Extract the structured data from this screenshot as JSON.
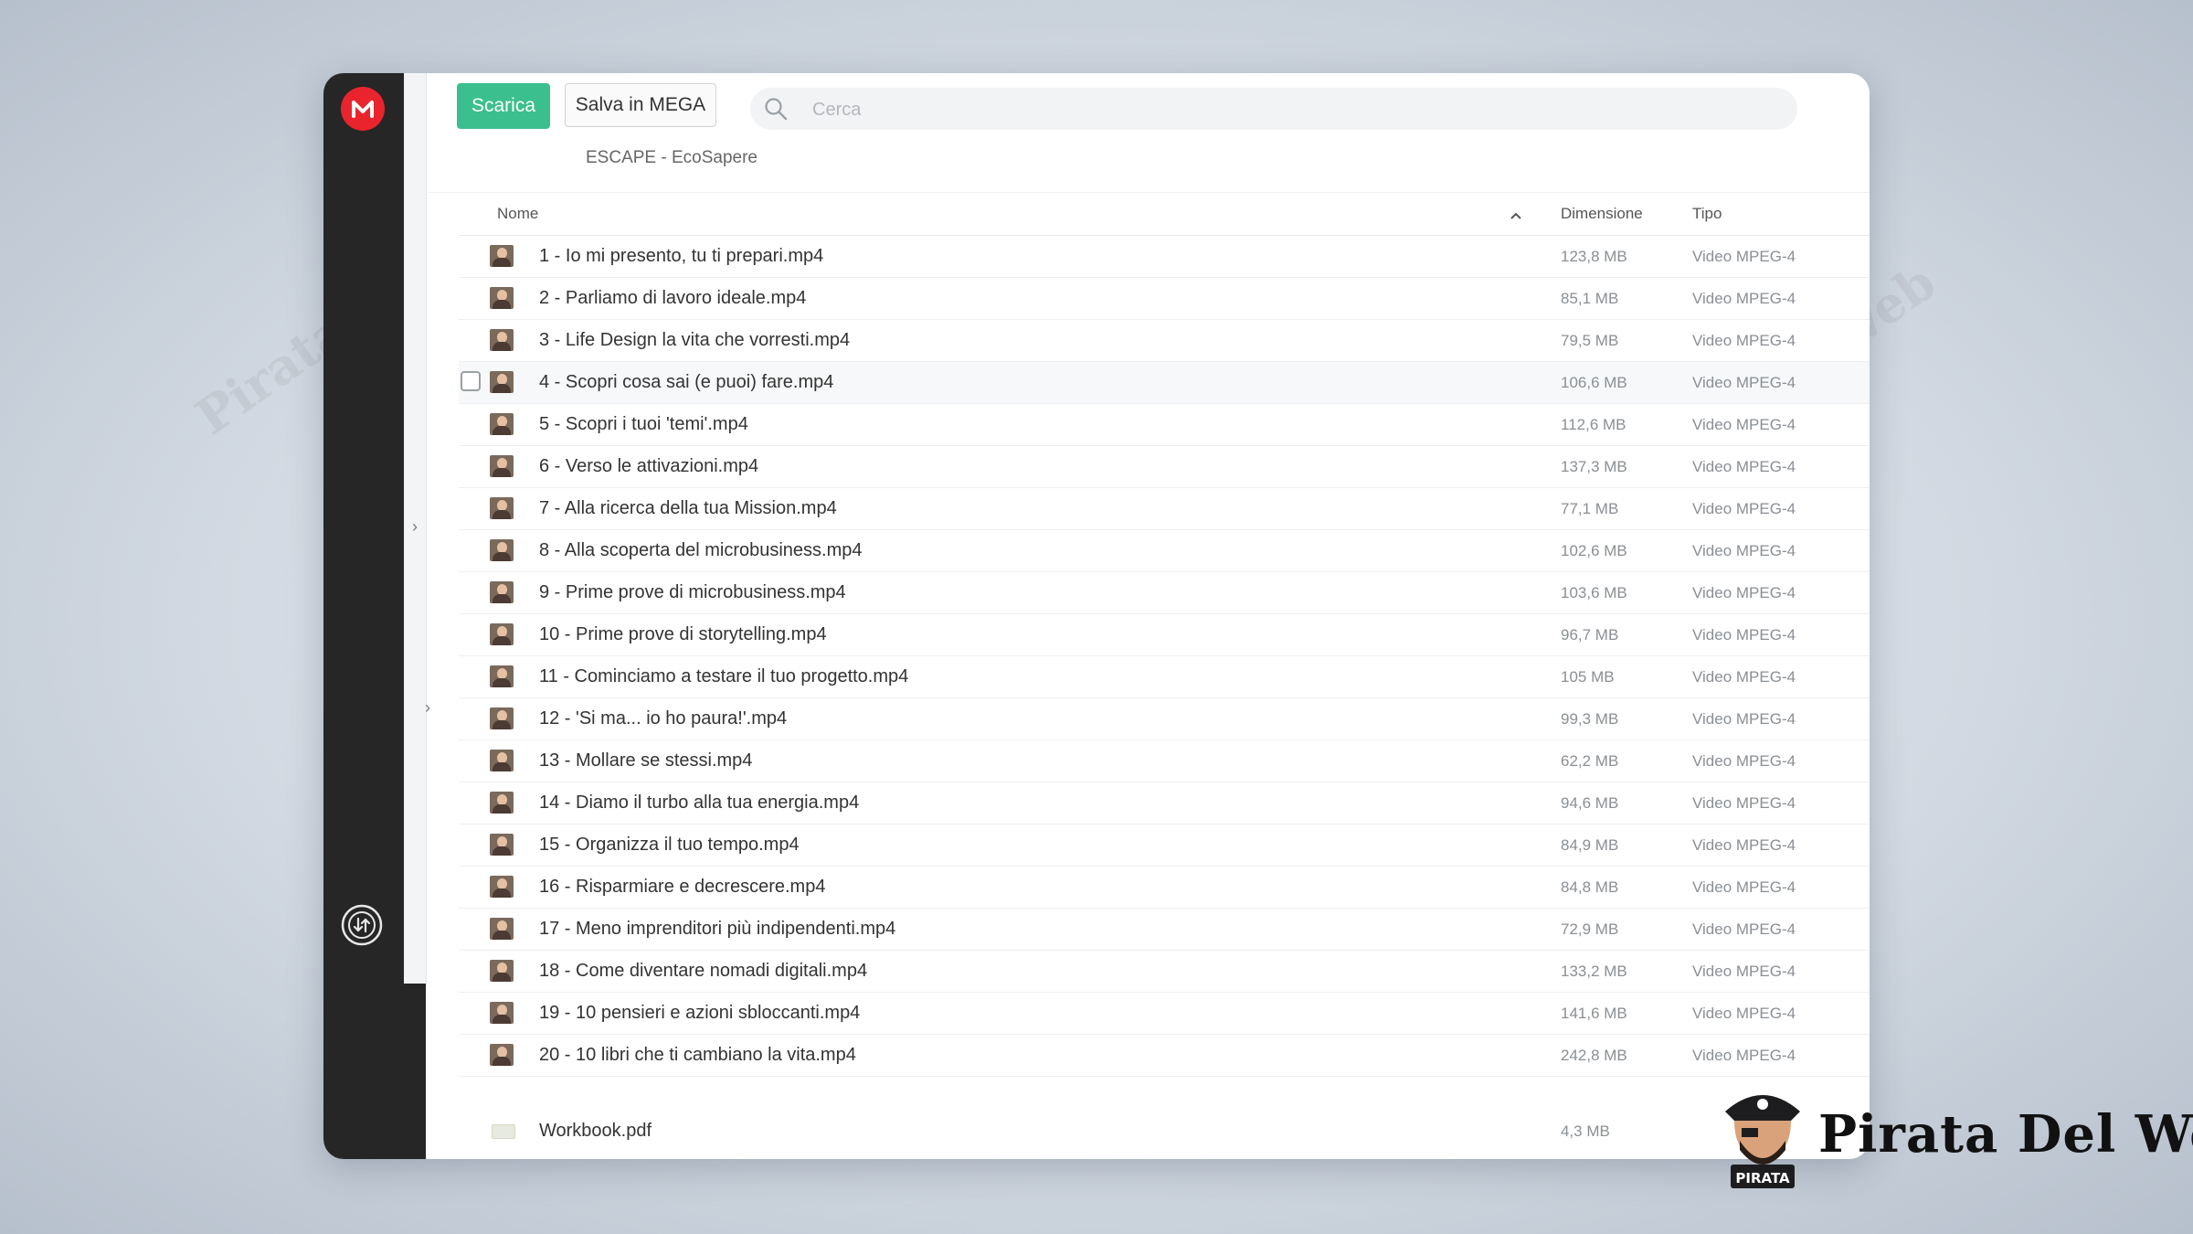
{
  "toolbar": {
    "download_label": "Scarica",
    "save_label": "Salva in MEGA"
  },
  "search": {
    "placeholder": "Cerca"
  },
  "breadcrumb": "ESCAPE - EcoSapere",
  "table": {
    "columns": {
      "name": "Nome",
      "size": "Dimensione",
      "type": "Tipo"
    },
    "rows": [
      {
        "name": "1 - Io mi presento, tu ti prepari.mp4",
        "size": "123,8 MB",
        "type": "Video MPEG-4"
      },
      {
        "name": "2 - Parliamo di lavoro ideale.mp4",
        "size": "85,1 MB",
        "type": "Video MPEG-4"
      },
      {
        "name": "3 - Life Design la vita che vorresti.mp4",
        "size": "79,5 MB",
        "type": "Video MPEG-4"
      },
      {
        "name": "4 - Scopri cosa sai (e puoi) fare.mp4",
        "size": "106,6 MB",
        "type": "Video MPEG-4"
      },
      {
        "name": "5 - Scopri i tuoi 'temi'.mp4",
        "size": "112,6 MB",
        "type": "Video MPEG-4"
      },
      {
        "name": "6 - Verso le attivazioni.mp4",
        "size": "137,3 MB",
        "type": "Video MPEG-4"
      },
      {
        "name": "7 - Alla ricerca della tua Mission.mp4",
        "size": "77,1 MB",
        "type": "Video MPEG-4"
      },
      {
        "name": "8 - Alla scoperta del microbusiness.mp4",
        "size": "102,6 MB",
        "type": "Video MPEG-4"
      },
      {
        "name": "9 - Prime prove di microbusiness.mp4",
        "size": "103,6 MB",
        "type": "Video MPEG-4"
      },
      {
        "name": "10 - Prime prove di storytelling.mp4",
        "size": "96,7 MB",
        "type": "Video MPEG-4"
      },
      {
        "name": "11 - Cominciamo a testare il tuo progetto.mp4",
        "size": "105 MB",
        "type": "Video MPEG-4"
      },
      {
        "name": "12 - 'Si ma... io ho paura!'.mp4",
        "size": "99,3 MB",
        "type": "Video MPEG-4"
      },
      {
        "name": "13 - Mollare se stessi.mp4",
        "size": "62,2 MB",
        "type": "Video MPEG-4"
      },
      {
        "name": "14 - Diamo il turbo alla tua energia.mp4",
        "size": "94,6 MB",
        "type": "Video MPEG-4"
      },
      {
        "name": "15 - Organizza il tuo tempo.mp4",
        "size": "84,9 MB",
        "type": "Video MPEG-4"
      },
      {
        "name": "16 - Risparmiare e decrescere.mp4",
        "size": "84,8 MB",
        "type": "Video MPEG-4"
      },
      {
        "name": "17 - Meno imprenditori più indipendenti.mp4",
        "size": "72,9 MB",
        "type": "Video MPEG-4"
      },
      {
        "name": "18 - Come diventare nomadi digitali.mp4",
        "size": "133,2 MB",
        "type": "Video MPEG-4"
      },
      {
        "name": "19 - 10 pensieri e azioni sbloccanti.mp4",
        "size": "141,6 MB",
        "type": "Video MPEG-4"
      },
      {
        "name": "20 - 10 libri che ti cambiano la vita.mp4",
        "size": "242,8 MB",
        "type": "Video MPEG-4"
      }
    ],
    "pdf_row": {
      "name": "Workbook.pdf",
      "size": "4,3 MB"
    }
  },
  "watermark": {
    "brand": "Pirata Del Web",
    "badge": "PIRATA"
  },
  "colors": {
    "accent": "#3bbf8e",
    "logo": "#e9242c",
    "sidebar": "#262626"
  }
}
